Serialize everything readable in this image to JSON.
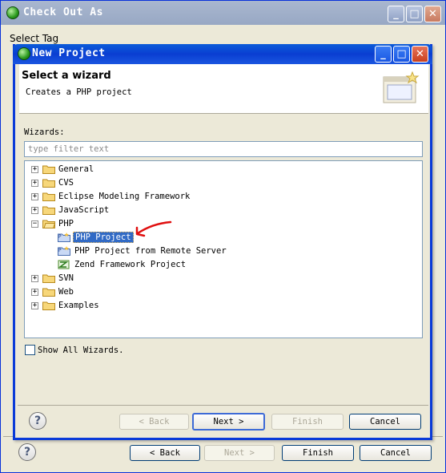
{
  "outer_dialog": {
    "title": "Check Out As",
    "section_label": "Select Tag",
    "buttons": {
      "back": "< Back",
      "next": "Next >",
      "finish": "Finish",
      "cancel": "Cancel"
    }
  },
  "inner_dialog": {
    "title": "New Project",
    "banner": {
      "title": "Select a wizard",
      "description": "Creates a PHP project"
    },
    "wizards_label": "Wizards:",
    "filter_placeholder": "type filter text",
    "tree": [
      {
        "label": "General",
        "expanded": false,
        "icon": "folder-icon"
      },
      {
        "label": "CVS",
        "expanded": false,
        "icon": "folder-icon"
      },
      {
        "label": "Eclipse Modeling Framework",
        "expanded": false,
        "icon": "folder-icon"
      },
      {
        "label": "JavaScript",
        "expanded": false,
        "icon": "folder-icon"
      },
      {
        "label": "PHP",
        "expanded": true,
        "icon": "folder-open-icon",
        "children": [
          {
            "label": "PHP Project",
            "selected": true,
            "icon": "php-project-icon"
          },
          {
            "label": "PHP Project from Remote Server",
            "icon": "php-project-icon"
          },
          {
            "label": "Zend Framework Project",
            "icon": "zend-project-icon"
          }
        ]
      },
      {
        "label": "SVN",
        "expanded": false,
        "icon": "folder-icon"
      },
      {
        "label": "Web",
        "expanded": false,
        "icon": "folder-icon"
      },
      {
        "label": "Examples",
        "expanded": false,
        "icon": "folder-icon"
      }
    ],
    "show_all_label": "Show All Wizards.",
    "show_all_checked": false,
    "buttons": {
      "back": "< Back",
      "next": "Next >",
      "finish": "Finish",
      "cancel": "Cancel"
    }
  },
  "colors": {
    "active_title": "#0a3ed2",
    "inactive_title": "#98a8c4",
    "selection": "#316ac5",
    "annotation_arrow": "#e01010"
  }
}
